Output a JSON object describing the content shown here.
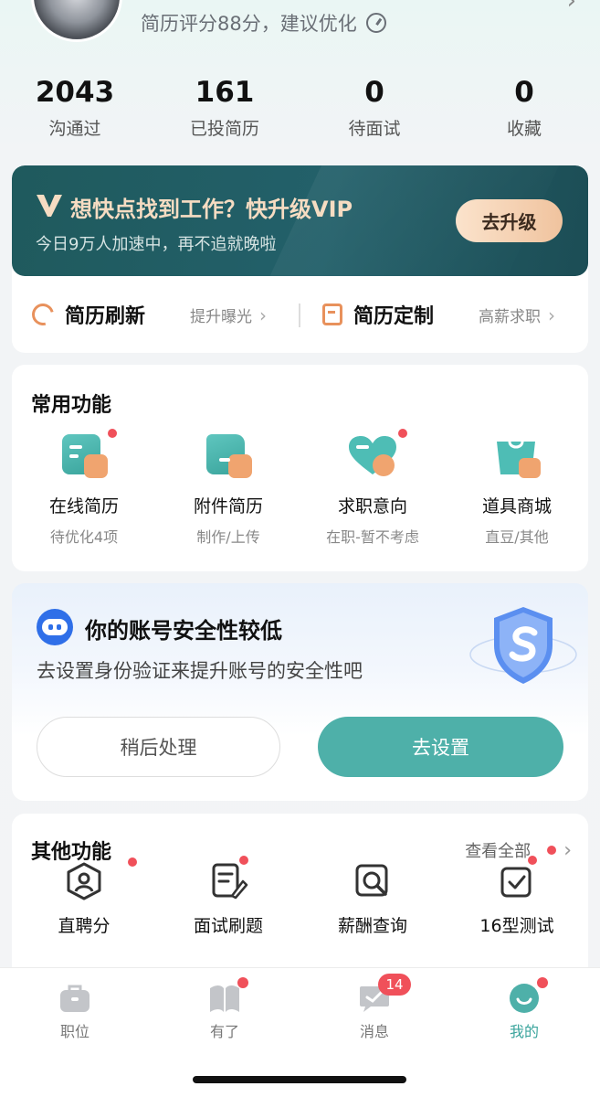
{
  "header": {
    "resume_score_text": "简历评分88分，建议优化"
  },
  "stats": [
    {
      "value": "2043",
      "label": "沟通过"
    },
    {
      "value": "161",
      "label": "已投简历"
    },
    {
      "value": "0",
      "label": "待面试"
    },
    {
      "value": "0",
      "label": "收藏"
    }
  ],
  "vip": {
    "title": "想快点找到工作？快升级VIP",
    "subtitle": "今日9万人加速中，再不追就晚啦",
    "button": "去升级"
  },
  "quick": [
    {
      "title": "简历刷新",
      "hint": "提升曝光"
    },
    {
      "title": "简历定制",
      "hint": "高薪求职"
    }
  ],
  "common_functions": {
    "title": "常用功能",
    "items": [
      {
        "label": "在线简历",
        "sub": "待优化4项"
      },
      {
        "label": "附件简历",
        "sub": "制作/上传"
      },
      {
        "label": "求职意向",
        "sub": "在职-暂不考虑"
      },
      {
        "label": "道具商城",
        "sub": "直豆/其他"
      }
    ]
  },
  "security": {
    "title": "你的账号安全性较低",
    "subtitle": "去设置身份验证来提升账号的安全性吧",
    "later_button": "稍后处理",
    "setup_button": "去设置"
  },
  "other_functions": {
    "title": "其他功能",
    "view_all": "查看全部",
    "items": [
      {
        "label": "直聘分"
      },
      {
        "label": "面试刷题"
      },
      {
        "label": "薪酬查询"
      },
      {
        "label": "16型测试"
      }
    ]
  },
  "tabbar": {
    "tabs": [
      {
        "label": "职位"
      },
      {
        "label": "有了"
      },
      {
        "label": "消息",
        "badge": "14"
      },
      {
        "label": "我的"
      }
    ]
  },
  "colors": {
    "accent": "#4eb0a9",
    "vip_bg": "#1f5a5d",
    "vip_gold": "#f6dcc2",
    "badge_red": "#f0505a",
    "orange": "#e8915c"
  }
}
